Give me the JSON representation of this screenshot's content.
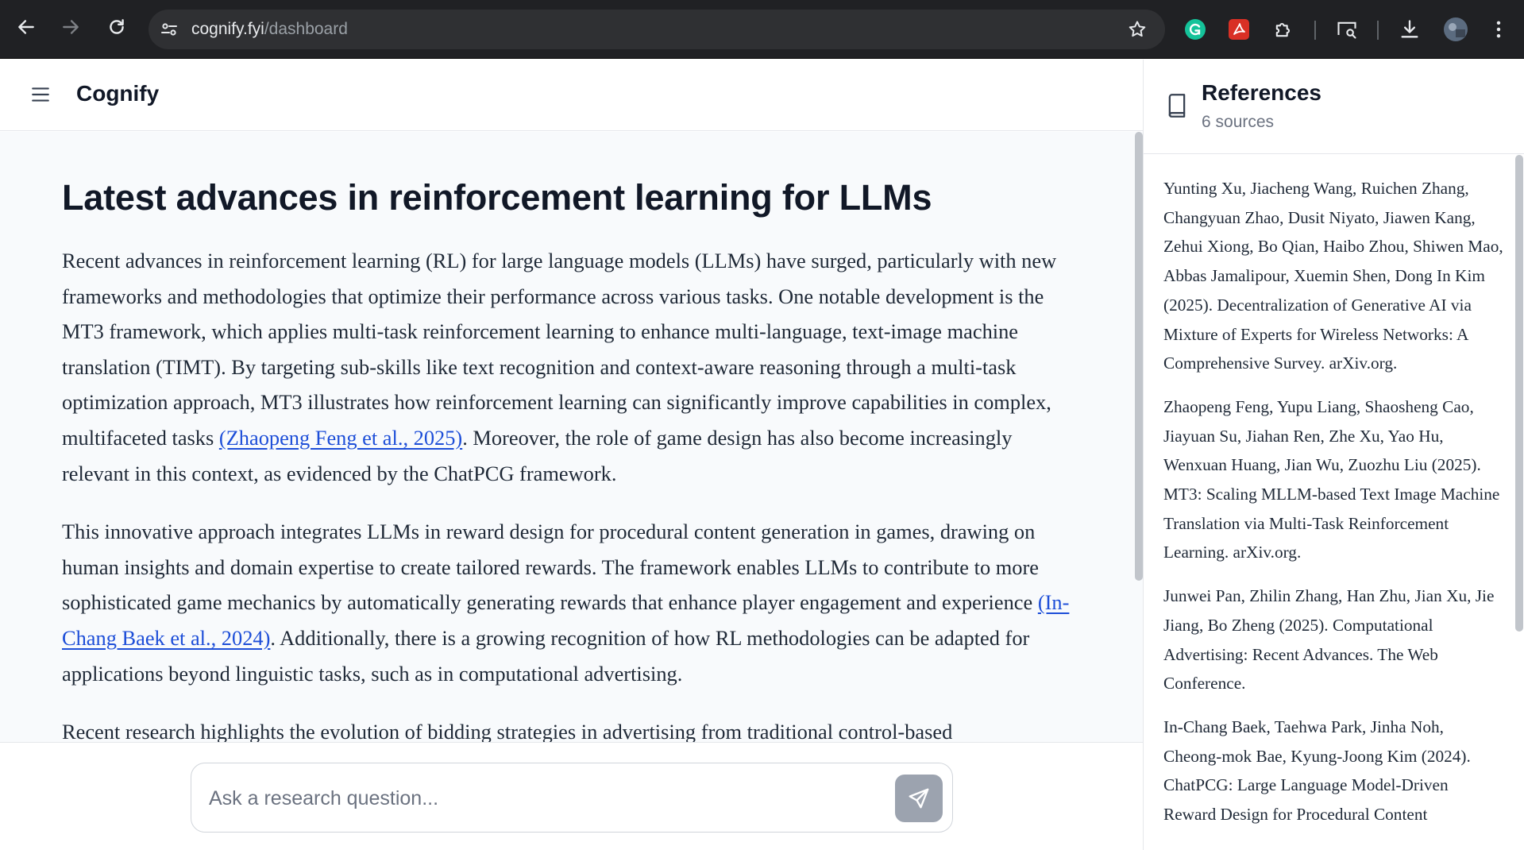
{
  "browser": {
    "url_domain": "cognify.fyi",
    "url_path": "/dashboard"
  },
  "app": {
    "brand": "Cognify"
  },
  "article": {
    "title": "Latest advances in reinforcement learning for LLMs",
    "p1_a": "Recent advances in reinforcement learning (RL) for large language models (LLMs) have surged, particularly with new frameworks and methodologies that optimize their performance across various tasks. One notable development is the MT3 framework, which applies multi-task reinforcement learning to enhance multi-language, text-image machine translation (TIMT). By targeting sub-skills like text recognition and context-aware reasoning through a multi-task optimization approach, MT3 illustrates how reinforcement learning can significantly improve capabilities in complex, multifaceted tasks ",
    "p1_cite": "(Zhaopeng Feng et al., 2025)",
    "p1_b": ". Moreover, the role of game design has also become increasingly relevant in this context, as evidenced by the ChatPCG framework.",
    "p2_a": "This innovative approach integrates LLMs in reward design for procedural content generation in games, drawing on human insights and domain expertise to create tailored rewards. The framework enables LLMs to contribute to more sophisticated game mechanics by automatically generating rewards that enhance player engagement and experience ",
    "p2_cite": "(In-Chang Baek et al., 2024)",
    "p2_b": ". Additionally, there is a growing recognition of how RL methodologies can be adapted for applications beyond linguistic tasks, such as in computational advertising.",
    "p3": "Recent research highlights the evolution of bidding strategies in advertising from traditional control-based"
  },
  "input": {
    "placeholder": "Ask a research question..."
  },
  "references": {
    "title": "References",
    "count": "6 sources",
    "items": [
      "Yunting Xu, Jiacheng Wang, Ruichen Zhang, Changyuan Zhao, Dusit Niyato, Jiawen Kang, Zehui Xiong, Bo Qian, Haibo Zhou, Shiwen Mao, Abbas Jamalipour, Xuemin Shen, Dong In Kim (2025). Decentralization of Generative AI via Mixture of Experts for Wireless Networks: A Comprehensive Survey. arXiv.org.",
      "Zhaopeng Feng, Yupu Liang, Shaosheng Cao, Jiayuan Su, Jiahan Ren, Zhe Xu, Yao Hu, Wenxuan Huang, Jian Wu, Zuozhu Liu (2025). MT3: Scaling MLLM-based Text Image Machine Translation via Multi-Task Reinforcement Learning. arXiv.org.",
      "Junwei Pan, Zhilin Zhang, Han Zhu, Jian Xu, Jie Jiang, Bo Zheng (2025). Computational Advertising: Recent Advances. The Web Conference.",
      "In-Chang Baek, Taehwa Park, Jinha Noh, Cheong-mok Bae, Kyung-Joong Kim (2024). ChatPCG: Large Language Model-Driven Reward Design for Procedural Content"
    ]
  },
  "icons": {
    "back": "arrow-left-icon",
    "forward": "arrow-right-icon",
    "reload": "reload-icon",
    "site_settings": "tune-icon",
    "bookmark": "star-icon",
    "extensions": [
      "grammarly-icon",
      "pdf-icon",
      "puzzle-icon",
      "cast-search-icon",
      "download-icon",
      "profile-avatar"
    ],
    "menu": "hamburger-menu-icon",
    "references": "book-icon",
    "send": "send-icon"
  },
  "colors": {
    "chrome_bg": "#202124",
    "link": "#1d4ed8",
    "send_button": "#9ca3af"
  }
}
